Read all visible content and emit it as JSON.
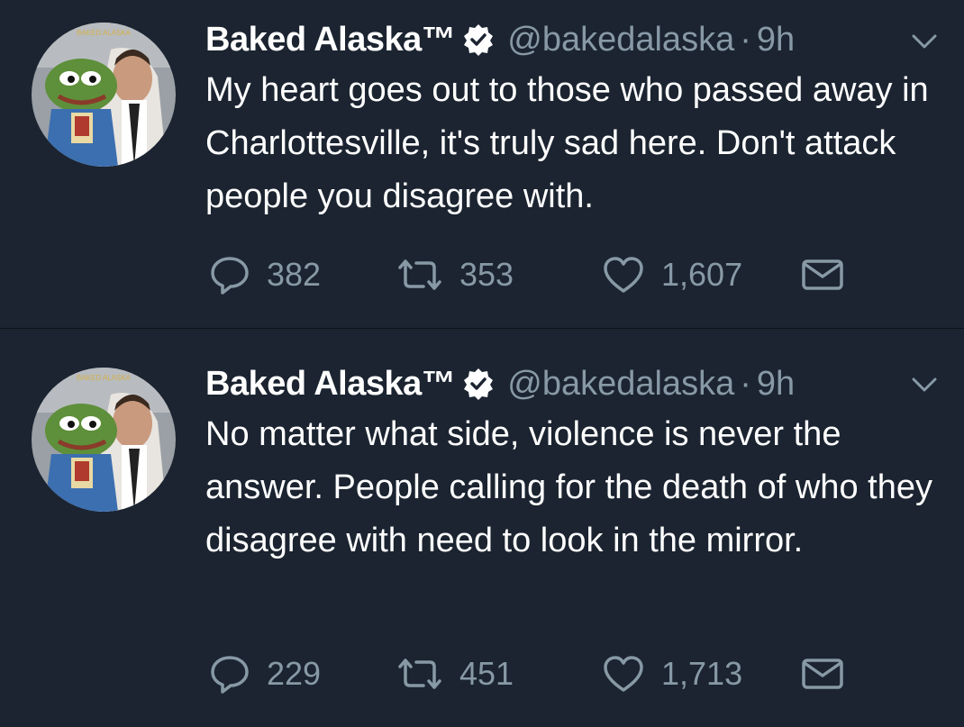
{
  "tweets": [
    {
      "author": {
        "name": "Baked Alaska™",
        "handle": "@bakedalaska",
        "verified_icon": "verified-badge-icon",
        "avatar_text": "BAKED ALASKA"
      },
      "separator": "·",
      "time": "9h",
      "text": "My heart goes out to those who passed away in Charlottesville, it's truly sad here. Don't attack people you disagree with.",
      "stats": {
        "replies": "382",
        "retweets": "353",
        "likes": "1,607"
      }
    },
    {
      "author": {
        "name": "Baked Alaska™",
        "handle": "@bakedalaska",
        "verified_icon": "verified-badge-icon",
        "avatar_text": "BAKED ALASKA"
      },
      "separator": "·",
      "time": "9h",
      "text": "No matter what side, violence is never the answer. People calling for the death of who they disagree with need to look in the mirror.",
      "stats": {
        "replies": "229",
        "retweets": "451",
        "likes": "1,713"
      }
    }
  ],
  "icons": {
    "reply": "reply-bubble-icon",
    "retweet": "retweet-icon",
    "like": "heart-icon",
    "dm": "envelope-icon",
    "more": "chevron-down-icon"
  },
  "colors": {
    "background": "#1b2430",
    "text": "#ffffff",
    "muted": "#8899a6",
    "verified_bg": "#ffffff",
    "verified_check": "#1b2430"
  }
}
